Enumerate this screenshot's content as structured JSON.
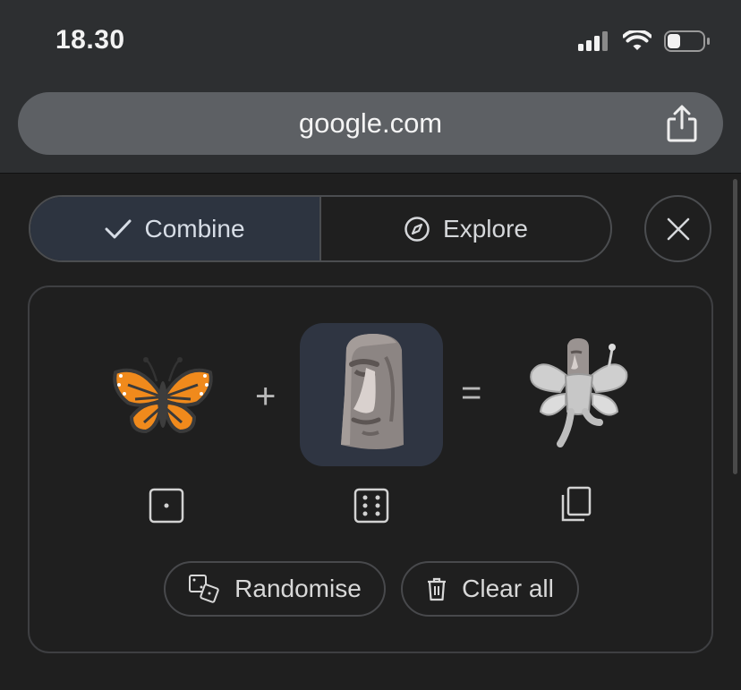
{
  "status_bar": {
    "time": "18.30",
    "icons": [
      "signal-icon",
      "wifi-icon",
      "battery-icon"
    ]
  },
  "browser": {
    "url": "google.com",
    "share_icon": "share-icon"
  },
  "mode_toggle": {
    "combine_label": "Combine",
    "explore_label": "Explore",
    "active": "Combine",
    "close_icon": "close-icon"
  },
  "combiner": {
    "first_emoji": "butterfly",
    "second_emoji": "moai",
    "result_emoji": "moai-fairy",
    "plus": "+",
    "equals": "=",
    "first_action_icon": "dice-one-icon",
    "second_action_icon": "dice-six-icon",
    "result_action_icon": "copy-icon",
    "randomise_label": "Randomise",
    "clear_label": "Clear all"
  },
  "colors": {
    "background": "#1f1f1f",
    "chrome": "#2d2f31",
    "url_bar": "#5d6064",
    "active_segment": "#2d3440",
    "selected_slot": "#2f3542"
  }
}
